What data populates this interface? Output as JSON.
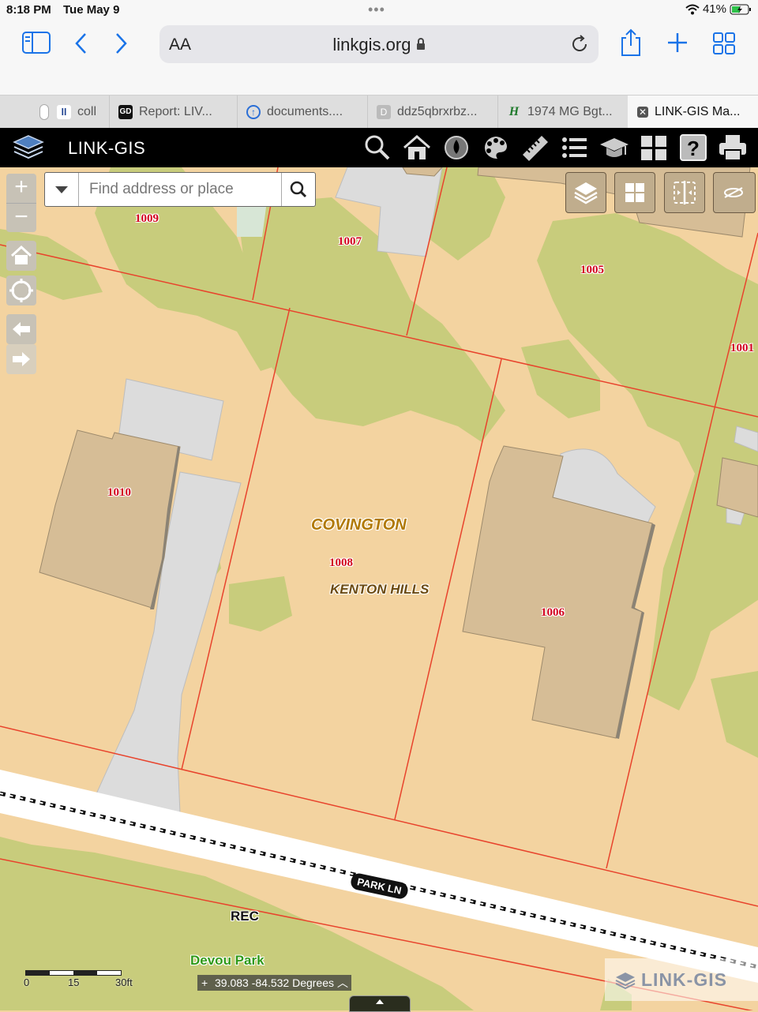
{
  "status_bar": {
    "time": "8:18 PM",
    "date": "Tue May 9",
    "battery": "41%"
  },
  "browser": {
    "text_size_label": "AA",
    "url": "linkgis.org",
    "tabs": [
      {
        "label": "coll",
        "favicon": "ll"
      },
      {
        "label": "Report: LIV...",
        "favicon": "GD"
      },
      {
        "label": "documents....",
        "favicon": "up-arrow"
      },
      {
        "label": "ddz5qbrxrbz...",
        "favicon": "D"
      },
      {
        "label": "1974 MG Bgt...",
        "favicon": "H"
      },
      {
        "label": "LINK-GIS Ma...",
        "favicon": "close"
      }
    ]
  },
  "app": {
    "title": "LINK-GIS",
    "tools": [
      "search-icon",
      "home-icon",
      "water-drop-icon",
      "palette-icon",
      "ruler-icon",
      "list-icon",
      "graduation-cap-icon",
      "grid-icon",
      "help-icon",
      "print-icon"
    ]
  },
  "map": {
    "search": {
      "placeholder": "Find address or place",
      "value": ""
    },
    "zoom_in": "+",
    "zoom_out": "−",
    "parcel_labels": [
      "1009",
      "1007",
      "1005",
      "1001",
      "1010",
      "1008",
      "1006"
    ],
    "city_label": "COVINGTON",
    "neighborhood_label": "KENTON HILLS",
    "street_label": "PARK LN",
    "zoning_label": "REC",
    "park_label": "Devou Park",
    "scale": {
      "labels": [
        "0",
        "15",
        "30ft"
      ]
    },
    "coordinates": "39.083 -84.532 Degrees",
    "watermark": "LINK-GIS",
    "colors": {
      "land": "#f3d3a0",
      "tree_canopy": "#c8cc7c",
      "building": "#d6bd96",
      "pavement": "#dcdcdc",
      "parcel_line": "#e8432c",
      "header": "#000000"
    }
  }
}
